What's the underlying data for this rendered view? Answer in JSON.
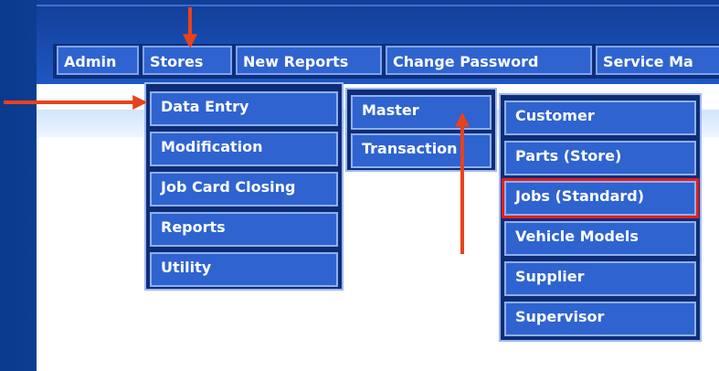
{
  "menubar": {
    "items": [
      "Admin",
      "Stores",
      "New Reports",
      "Change Password",
      "Service Ma"
    ]
  },
  "stores_menu": {
    "items": [
      "Data Entry",
      "Modification",
      "Job Card Closing",
      "Reports",
      "Utility"
    ]
  },
  "data_entry_menu": {
    "items": [
      "Master",
      "Transaction"
    ]
  },
  "master_menu": {
    "items": [
      "Customer",
      "Parts (Store)",
      "Jobs (Standard)",
      "Vehicle Models",
      "Supplier",
      "Supervisor"
    ]
  },
  "colors": {
    "menu_fill": "#2f63d0",
    "menu_bar": "#0f2f7a",
    "highlight": "#e41e1e",
    "arrow": "#e8421c"
  }
}
